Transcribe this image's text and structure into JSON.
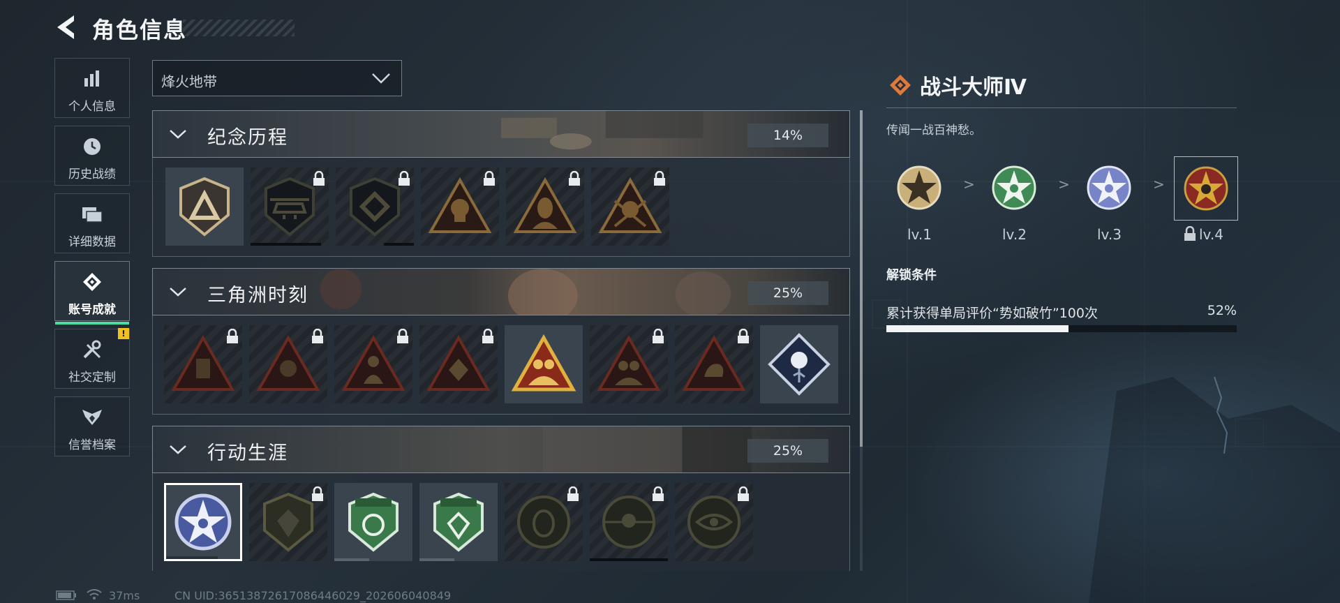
{
  "header": {
    "title": "角色信息",
    "back_icon": "back-arrow-icon"
  },
  "sidebar": {
    "items": [
      {
        "label": "个人信息",
        "icon": "bar-chart-icon",
        "active": false
      },
      {
        "label": "历史战绩",
        "icon": "clock-icon",
        "active": false
      },
      {
        "label": "详细数据",
        "icon": "folder-icon",
        "active": false
      },
      {
        "label": "账号成就",
        "icon": "achievement-icon",
        "active": true
      },
      {
        "label": "社交定制",
        "icon": "tools-icon",
        "active": false,
        "alert": "!"
      },
      {
        "label": "信誉档案",
        "icon": "wings-icon",
        "active": false
      }
    ]
  },
  "filter": {
    "selected": "烽火地带"
  },
  "sections": [
    {
      "name": "纪念历程",
      "percent": "14%",
      "badges": [
        {
          "icon": "triangle-shield-badge-icon",
          "locked": false,
          "progress": null
        },
        {
          "icon": "helicopter-badge-icon",
          "locked": true,
          "progress": 0.9
        },
        {
          "icon": "diamond-shield-badge-icon",
          "locked": true,
          "progress": 0.38
        },
        {
          "icon": "skull-triangle-badge-icon",
          "locked": true,
          "progress": null
        },
        {
          "icon": "woman-triangle-badge-icon",
          "locked": true,
          "progress": null
        },
        {
          "icon": "soldier-triangle-badge-icon",
          "locked": true,
          "progress": null
        }
      ]
    },
    {
      "name": "三角洲时刻",
      "percent": "25%",
      "badges": [
        {
          "icon": "backpack-triangle-badge-icon",
          "locked": true,
          "progress": null
        },
        {
          "icon": "skull-triangle-badge-icon",
          "locked": true,
          "progress": null
        },
        {
          "icon": "figure-triangle-badge-icon",
          "locked": true,
          "progress": null
        },
        {
          "icon": "gem-triangle-badge-icon",
          "locked": true,
          "progress": null
        },
        {
          "icon": "team-gold-triangle-badge-icon",
          "locked": false,
          "progress": null
        },
        {
          "icon": "team-triangle-badge-icon",
          "locked": true,
          "progress": null
        },
        {
          "icon": "hand-triangle-badge-icon",
          "locked": true,
          "progress": null
        },
        {
          "icon": "rose-diamond-badge-icon",
          "locked": false,
          "progress": null
        }
      ]
    },
    {
      "name": "行动生涯",
      "percent": "25%",
      "badges": [
        {
          "icon": "blue-star-badge-icon",
          "locked": false,
          "selected": true,
          "progress": 0.7
        },
        {
          "icon": "dark-shield-badge-icon",
          "locked": true,
          "progress": null
        },
        {
          "icon": "green-shield-badge-icon",
          "locked": false,
          "progress": 0.45
        },
        {
          "icon": "green-shield-star-badge-icon",
          "locked": false,
          "progress": 0.45
        },
        {
          "icon": "circle-shell-badge-icon",
          "locked": true,
          "progress": null
        },
        {
          "icon": "circle-soldier-badge-icon",
          "locked": true,
          "progress": 1.0
        },
        {
          "icon": "circle-eye-badge-icon",
          "locked": true,
          "progress": null
        }
      ]
    }
  ],
  "detail": {
    "title": "战斗大师Ⅳ",
    "title_icon": "diamond-logo-icon",
    "description": "传闻一战百神愁。",
    "levels": [
      {
        "label": "lv.1",
        "color": "#c9b07a",
        "locked": false
      },
      {
        "label": "lv.2",
        "color": "#3f8a55",
        "locked": false
      },
      {
        "label": "lv.3",
        "color": "#7884c8",
        "locked": false
      },
      {
        "label": "lv.4",
        "color": "#8a2a22",
        "locked": true,
        "selected": true
      }
    ],
    "separator": ">",
    "unlock_heading": "解锁条件",
    "condition": "累计获得单局评价“势如破竹”100次",
    "condition_percent": "52%",
    "progress": 0.52
  },
  "footer": {
    "ping": "37ms",
    "uid": "CN UID:3651387261708644602​9_202606040849"
  },
  "colors": {
    "accent": "#4fdca0",
    "alert": "#f0c020",
    "logo": "#e07a3a"
  }
}
